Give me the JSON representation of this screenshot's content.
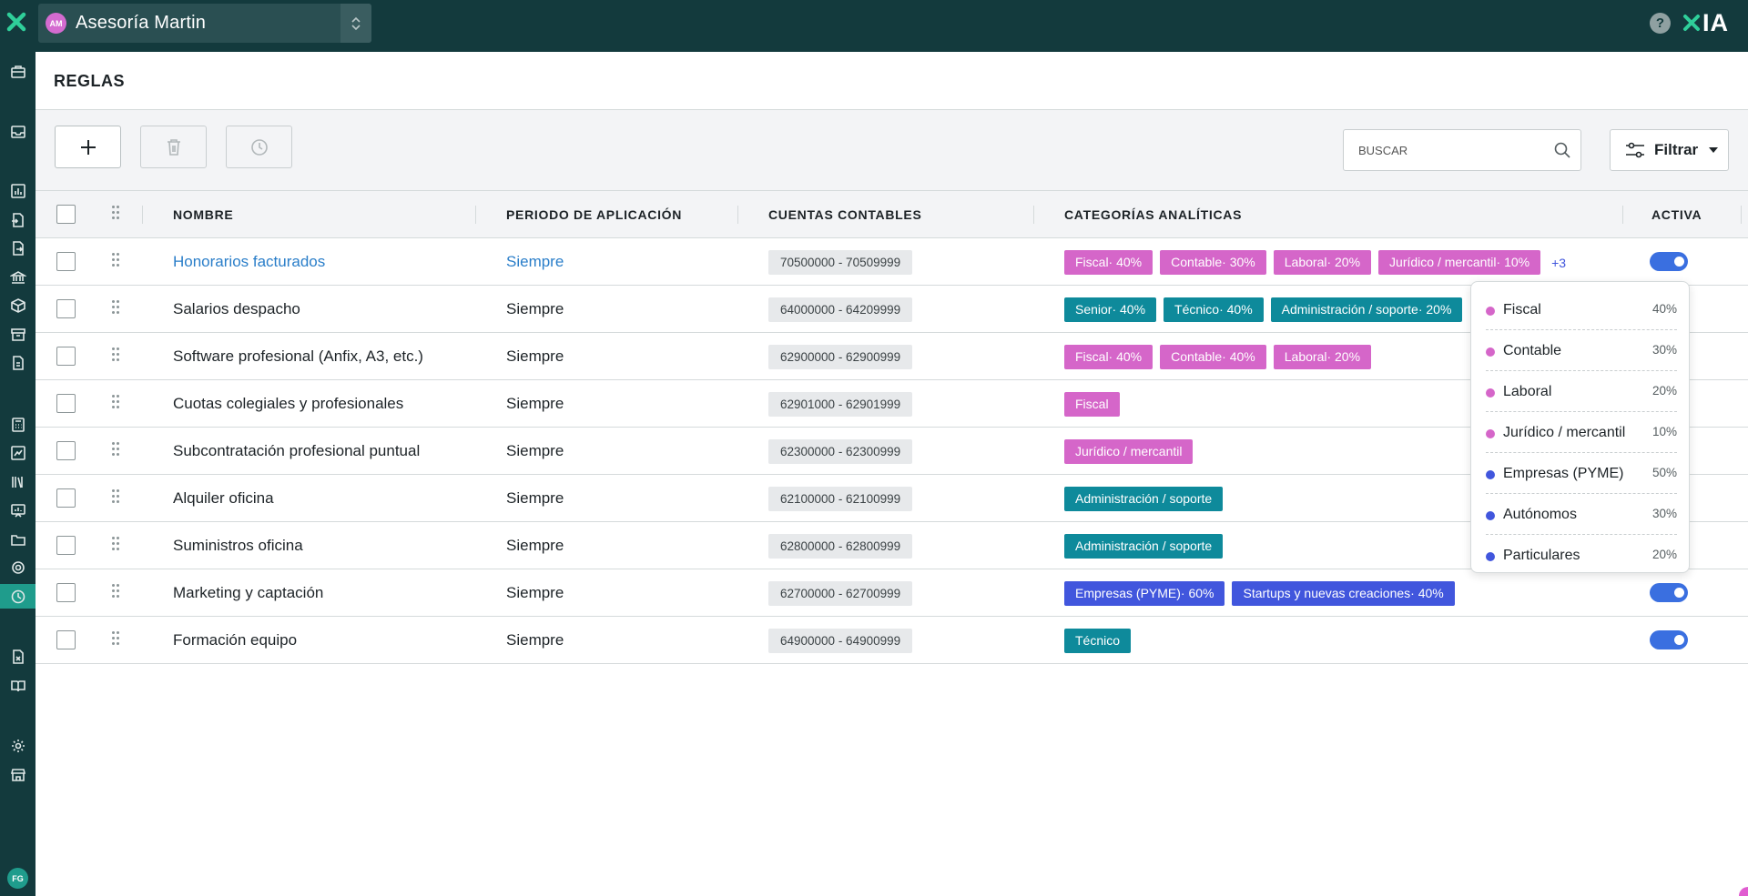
{
  "header": {
    "org_initials": "AM",
    "org_name": "Asesoría Martin",
    "help_label": "?",
    "brand_text": "IA"
  },
  "user": {
    "initials": "FG"
  },
  "page": {
    "title": "REGLAS"
  },
  "toolbar": {
    "search_placeholder": "BUSCAR",
    "filter_label": "Filtrar"
  },
  "table": {
    "columns": {
      "name": "NOMBRE",
      "period": "PERIODO DE APLICACIÓN",
      "accounts": "CUENTAS CONTABLES",
      "categories": "CATEGORÍAS ANALÍTICAS",
      "active": "ACTIVA"
    },
    "rows": [
      {
        "name": "Honorarios facturados",
        "period": "Siempre",
        "account": "70500000 - 70509999",
        "tags": [
          "Fiscal· 40%",
          "Contable· 30%",
          "Laboral· 20%",
          "Jurídico / mercantil· 10%"
        ],
        "more": "+3"
      },
      {
        "name": "Salarios despacho",
        "period": "Siempre",
        "account": "64000000 - 64209999",
        "tags": [
          "Senior· 40%",
          "Técnico· 40%",
          "Administración / soporte· 20%"
        ]
      },
      {
        "name": "Software profesional (Anfix, A3, etc.)",
        "period": "Siempre",
        "account": "62900000 - 62900999",
        "tags": [
          "Fiscal· 40%",
          "Contable· 40%",
          "Laboral· 20%"
        ]
      },
      {
        "name": "Cuotas colegiales y profesionales",
        "period": "Siempre",
        "account": "62901000 - 62901999",
        "tags": [
          "Fiscal"
        ]
      },
      {
        "name": "Subcontratación profesional puntual",
        "period": "Siempre",
        "account": "62300000 - 62300999",
        "tags": [
          "Jurídico / mercantil"
        ]
      },
      {
        "name": "Alquiler oficina",
        "period": "Siempre",
        "account": "62100000 - 62100999",
        "tags": [
          "Administración / soporte"
        ]
      },
      {
        "name": "Suministros oficina",
        "period": "Siempre",
        "account": "62800000 - 62800999",
        "tags": [
          "Administración / soporte"
        ]
      },
      {
        "name": "Marketing y captación",
        "period": "Siempre",
        "account": "62700000 - 62700999",
        "tags": [
          "Empresas (PYME)· 60%",
          "Startups y nuevas creaciones· 40%"
        ]
      },
      {
        "name": "Formación equipo",
        "period": "Siempre",
        "account": "64900000 - 64900999",
        "tags": [
          "Técnico"
        ]
      }
    ]
  },
  "popover": {
    "items": [
      {
        "label": "Fiscal",
        "value": "40%"
      },
      {
        "label": "Contable",
        "value": "30%"
      },
      {
        "label": "Laboral",
        "value": "20%"
      },
      {
        "label": "Jurídico / mercantil",
        "value": "10%"
      },
      {
        "label": "Empresas (PYME)",
        "value": "50%"
      },
      {
        "label": "Autónomos",
        "value": "30%"
      },
      {
        "label": "Particulares",
        "value": "20%"
      }
    ]
  },
  "colors": {
    "topbar": "#133a3d",
    "pink": "#d566c9",
    "teal": "#0e8a9b",
    "blue": "#4156dd",
    "link": "#2a7ec9",
    "toggle": "#3a6fe0"
  }
}
